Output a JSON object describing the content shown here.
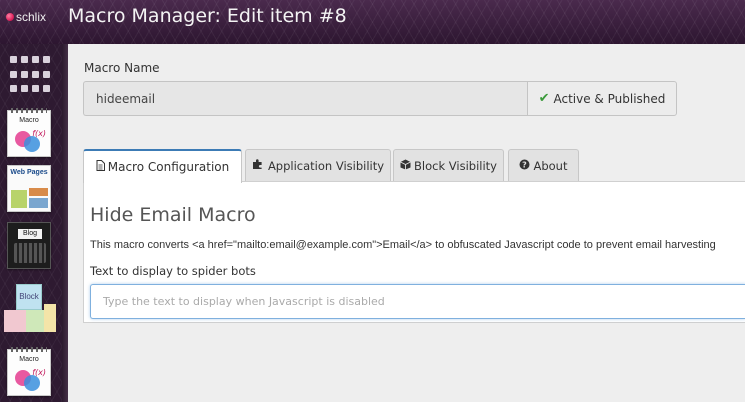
{
  "app": {
    "logo_text": "schlix",
    "title": "Macro Manager: Edit item #8"
  },
  "sidebar": {
    "items": [
      {
        "label": "Macro"
      },
      {
        "label": "Web Pages"
      },
      {
        "label": "Blog"
      },
      {
        "label": "Block"
      },
      {
        "label": "Macro"
      }
    ]
  },
  "form": {
    "macro_name_label": "Macro Name",
    "macro_name_value": "hideemail",
    "status_label": "Active & Published"
  },
  "tabs": [
    {
      "label": "Macro Configuration",
      "icon": "file-icon",
      "active": true
    },
    {
      "label": "Application Visibility",
      "icon": "puzzle-icon",
      "active": false
    },
    {
      "label": "Block Visibility",
      "icon": "cube-icon",
      "active": false
    },
    {
      "label": "About",
      "icon": "question-circle-icon",
      "active": false
    }
  ],
  "panel": {
    "title": "Hide Email Macro",
    "description": "This macro converts <a href=\"mailto:email@example.com\">Email</a> to obfuscated Javascript code to prevent email harvesting",
    "field_label": "Text to display to spider bots",
    "field_placeholder": "Type the text to display when Javascript is disabled"
  },
  "colors": {
    "header_bg": "#3a1f3c",
    "active_tab_accent": "#3c7bb5",
    "status_check": "#3a9a3a"
  }
}
